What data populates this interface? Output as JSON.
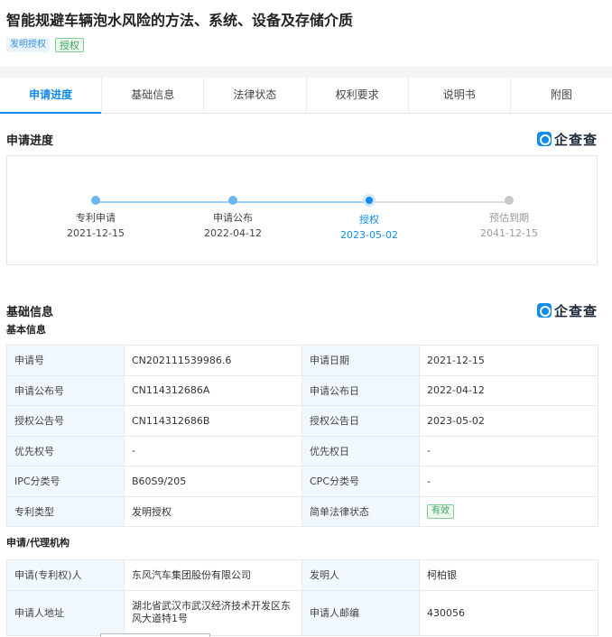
{
  "title": "智能规避车辆泡水风险的方法、系统、设备及存储介质",
  "tags": [
    "发明授权",
    "授权"
  ],
  "tabs": [
    "申请进度",
    "基础信息",
    "法律状态",
    "权利要求",
    "说明书",
    "附图"
  ],
  "brand": "企查查",
  "progress": {
    "title": "申请进度",
    "steps": [
      {
        "label": "专利申请",
        "date": "2021-12-15",
        "state": "done"
      },
      {
        "label": "申请公布",
        "date": "2022-04-12",
        "state": "done"
      },
      {
        "label": "授权",
        "date": "2023-05-02",
        "state": "current"
      },
      {
        "label": "预估到期",
        "date": "2041-12-15",
        "state": "future"
      }
    ]
  },
  "basic": {
    "title": "基础信息",
    "sub_title": "基本信息",
    "rows": [
      [
        "申请号",
        "CN202111539986.6",
        "申请日期",
        "2021-12-15"
      ],
      [
        "申请公布号",
        "CN114312686A",
        "申请公布日",
        "2022-04-12"
      ],
      [
        "授权公告号",
        "CN114312686B",
        "授权公告日",
        "2023-05-02"
      ],
      [
        "优先权号",
        "-",
        "优先权日",
        "-"
      ],
      [
        "IPC分类号",
        "B60S9/205",
        "CPC分类号",
        "-"
      ],
      [
        "专利类型",
        "发明授权",
        "简单法律状态",
        "有效"
      ]
    ]
  },
  "agency": {
    "sub_title": "申请/代理机构",
    "rows": [
      [
        "申请(专利权)人",
        "东风汽车集团股份有限公司",
        "发明人",
        "柯柏银"
      ],
      [
        "申请人地址",
        "湖北省武汉市武汉经济技术开发区东风大道特1号",
        "申请人邮编",
        "430056"
      ]
    ]
  }
}
